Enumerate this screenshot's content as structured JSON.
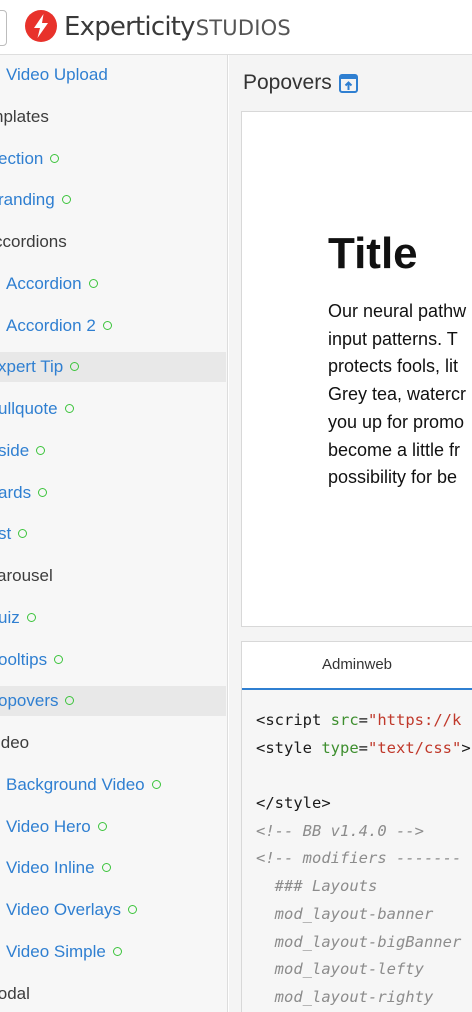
{
  "header": {
    "brand": "Experticity",
    "brand_suffix": "STUDIOS",
    "colors": {
      "logo_red": "#e8322b",
      "link_blue": "#2f7fd1",
      "status_green": "#3cc43c"
    }
  },
  "sidebar": {
    "items": [
      {
        "label": "Video Upload",
        "type": "link",
        "dot": false
      },
      {
        "label": "nplates",
        "type": "heading",
        "dot": false
      },
      {
        "label": "ection",
        "type": "link",
        "dot": true
      },
      {
        "label": "randing",
        "type": "link",
        "dot": true
      },
      {
        "label": "ccordions",
        "type": "heading",
        "dot": false
      },
      {
        "label": "Accordion",
        "type": "link",
        "dot": true
      },
      {
        "label": "Accordion 2",
        "type": "link",
        "dot": true
      },
      {
        "label": "xpert Tip",
        "type": "link",
        "dot": true,
        "active": true
      },
      {
        "label": "ullquote",
        "type": "link",
        "dot": true
      },
      {
        "label": "side",
        "type": "link",
        "dot": true
      },
      {
        "label": "ards",
        "type": "link",
        "dot": true
      },
      {
        "label": "st",
        "type": "link",
        "dot": true
      },
      {
        "label": "arousel",
        "type": "heading",
        "dot": false
      },
      {
        "label": "uiz",
        "type": "link",
        "dot": true
      },
      {
        "label": "ooltips",
        "type": "link",
        "dot": true
      },
      {
        "label": "opovers",
        "type": "link",
        "dot": true,
        "active": true
      },
      {
        "label": "ideo",
        "type": "heading",
        "dot": false
      },
      {
        "label": "Background Video",
        "type": "link",
        "dot": true
      },
      {
        "label": "Video Hero",
        "type": "link",
        "dot": true
      },
      {
        "label": "Video Inline",
        "type": "link",
        "dot": true
      },
      {
        "label": "Video Overlays",
        "type": "link",
        "dot": true
      },
      {
        "label": "Video Simple",
        "type": "link",
        "dot": true
      },
      {
        "label": "lodal",
        "type": "heading",
        "dot": false
      }
    ]
  },
  "main": {
    "page_title": "Popovers",
    "preview": {
      "title": "Title",
      "body_lines": [
        "Our neural pathw",
        "input patterns. T",
        "protects fools, lit",
        "Grey tea, watercr",
        "you up for promo",
        "become a little fr",
        "possibility for be"
      ]
    },
    "code_panel": {
      "tab_label": "Adminweb",
      "lines": [
        {
          "parts": [
            {
              "cls": "c-tag",
              "text": "<script "
            },
            {
              "cls": "c-attr",
              "text": "src"
            },
            {
              "cls": "c-tag",
              "text": "="
            },
            {
              "cls": "c-str",
              "text": "\"https://k"
            }
          ]
        },
        {
          "parts": [
            {
              "cls": "c-tag",
              "text": "<style "
            },
            {
              "cls": "c-attr",
              "text": "type"
            },
            {
              "cls": "c-tag",
              "text": "="
            },
            {
              "cls": "c-str",
              "text": "\"text/css\""
            },
            {
              "cls": "c-tag",
              "text": ">"
            }
          ]
        },
        {
          "parts": [
            {
              "cls": "c-tag",
              "text": ""
            }
          ]
        },
        {
          "parts": [
            {
              "cls": "c-tag",
              "text": "</style>"
            }
          ]
        },
        {
          "parts": [
            {
              "cls": "c-com",
              "text": "<!-- BB v1.4.0 -->"
            }
          ]
        },
        {
          "parts": [
            {
              "cls": "c-com",
              "text": "<!-- modifiers -------"
            }
          ]
        },
        {
          "parts": [
            {
              "cls": "c-com",
              "text": "  ### Layouts"
            }
          ]
        },
        {
          "parts": [
            {
              "cls": "c-com",
              "text": "  mod_layout-banner"
            }
          ]
        },
        {
          "parts": [
            {
              "cls": "c-com",
              "text": "  mod_layout-bigBanner"
            }
          ]
        },
        {
          "parts": [
            {
              "cls": "c-com",
              "text": "  mod_layout-lefty"
            }
          ]
        },
        {
          "parts": [
            {
              "cls": "c-com",
              "text": "  mod_layout-righty"
            }
          ]
        }
      ]
    }
  }
}
